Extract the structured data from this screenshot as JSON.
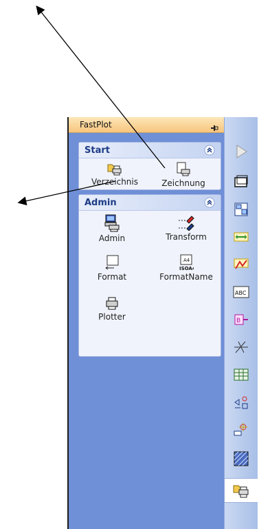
{
  "panel": {
    "title": "FastPlot"
  },
  "groups": [
    {
      "title": "Start",
      "tools": [
        {
          "label": "Verzeichnis",
          "icon": "folder-printer-icon"
        },
        {
          "label": "Zeichnung",
          "icon": "document-printer-icon"
        }
      ]
    },
    {
      "title": "Admin",
      "tools": [
        {
          "label": "Admin",
          "icon": "computer-printer-icon"
        },
        {
          "label": "Transform",
          "icon": "pen-transform-icon"
        },
        {
          "label": "Format",
          "icon": "format-sheet-icon"
        },
        {
          "label": "FormatName",
          "icon": "iso-a4-icon"
        },
        {
          "label": "Plotter",
          "icon": "printer-icon"
        }
      ]
    }
  ],
  "toolbar_icons": [
    "play-arrow-icon",
    "window-icon",
    "layout-icon",
    "dimension-icon",
    "redline-icon",
    "abc-text-icon",
    "label-tag-icon",
    "hatch-icon",
    "table-grid-icon",
    "measure-icon",
    "crosshair-icon",
    "fill-pattern-icon",
    "fastplot-printer-icon"
  ],
  "colors": {
    "panel_background": "#6f8fd6",
    "header_gradient": "#f7c57d",
    "group_title": "#1d3c86"
  }
}
